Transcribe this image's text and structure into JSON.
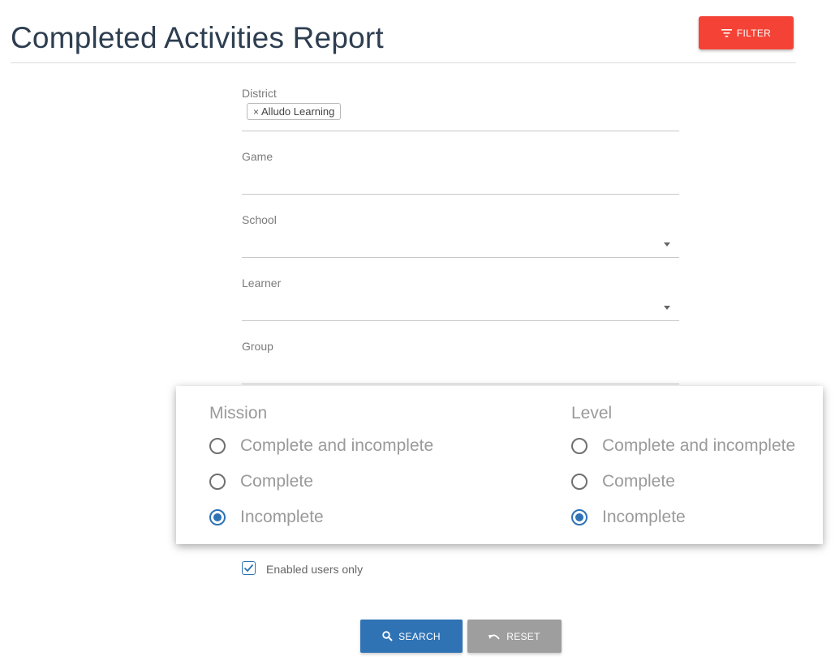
{
  "header": {
    "title": "Completed Activities Report",
    "filter_label": "FILTER"
  },
  "form": {
    "district": {
      "label": "District",
      "chips": [
        "Alludo Learning"
      ]
    },
    "game": {
      "label": "Game"
    },
    "school": {
      "label": "School"
    },
    "learner": {
      "label": "Learner"
    },
    "group": {
      "label": "Group"
    },
    "enabled_users_only": {
      "label": "Enabled users only",
      "checked": true
    }
  },
  "radio_groups": {
    "mission": {
      "title": "Mission",
      "options": [
        "Complete and incomplete",
        "Complete",
        "Incomplete"
      ],
      "selected": "Incomplete"
    },
    "level": {
      "title": "Level",
      "options": [
        "Complete and incomplete",
        "Complete",
        "Incomplete"
      ],
      "selected": "Incomplete"
    }
  },
  "actions": {
    "search_label": "SEARCH",
    "reset_label": "RESET"
  },
  "colors": {
    "primary": "#2f73b5",
    "filter": "#f44336",
    "reset": "#9e9e9e"
  },
  "icons": {
    "filter": "filter-lines-icon",
    "search": "magnifier-icon",
    "reset": "undo-arrow-icon",
    "chip_remove": "close-icon",
    "dropdown": "caret-down-icon",
    "check": "checkmark-icon"
  }
}
